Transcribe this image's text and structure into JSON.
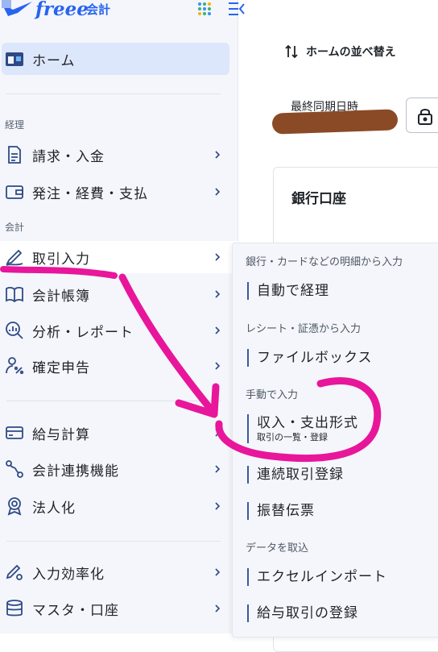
{
  "brand": {
    "logo_text": "freee",
    "logo_sub": "会計"
  },
  "sidebar": {
    "home": {
      "label": "ホーム"
    },
    "sections": [
      {
        "label": "経理",
        "items": [
          {
            "label": "請求・入金"
          },
          {
            "label": "発注・経費・支払"
          }
        ]
      },
      {
        "label": "会計",
        "items": [
          {
            "label": "取引入力"
          },
          {
            "label": "会計帳簿"
          },
          {
            "label": "分析・レポート"
          },
          {
            "label": "確定申告"
          }
        ]
      },
      {
        "label": "",
        "items": [
          {
            "label": "給与計算"
          },
          {
            "label": "会計連携機能"
          },
          {
            "label": "法人化"
          }
        ]
      },
      {
        "label": "",
        "items": [
          {
            "label": "入力効率化"
          },
          {
            "label": "マスタ・口座"
          }
        ]
      }
    ]
  },
  "main": {
    "sort_label": "ホームの並べ替え",
    "sync_label": "最終同期日時",
    "bank_card_title": "銀行口座"
  },
  "submenu": {
    "groups": [
      {
        "label": "銀行・カードなどの明細から入力",
        "items": [
          {
            "label": "自動で経理"
          }
        ]
      },
      {
        "label": "レシート・証憑から入力",
        "items": [
          {
            "label": "ファイルボックス"
          }
        ]
      },
      {
        "label": "手動で入力",
        "items": [
          {
            "label": "収入・支出形式",
            "desc": "取引の一覧・登録"
          },
          {
            "label": "連続取引登録"
          },
          {
            "label": "振替伝票"
          }
        ]
      },
      {
        "label": "データを取込",
        "items": [
          {
            "label": "エクセルインポート"
          },
          {
            "label": "給与取引の登録"
          }
        ]
      }
    ]
  },
  "colors": {
    "accent": "#2864f0",
    "annotation": "#e8169b",
    "redaction": "#8a4a26"
  }
}
